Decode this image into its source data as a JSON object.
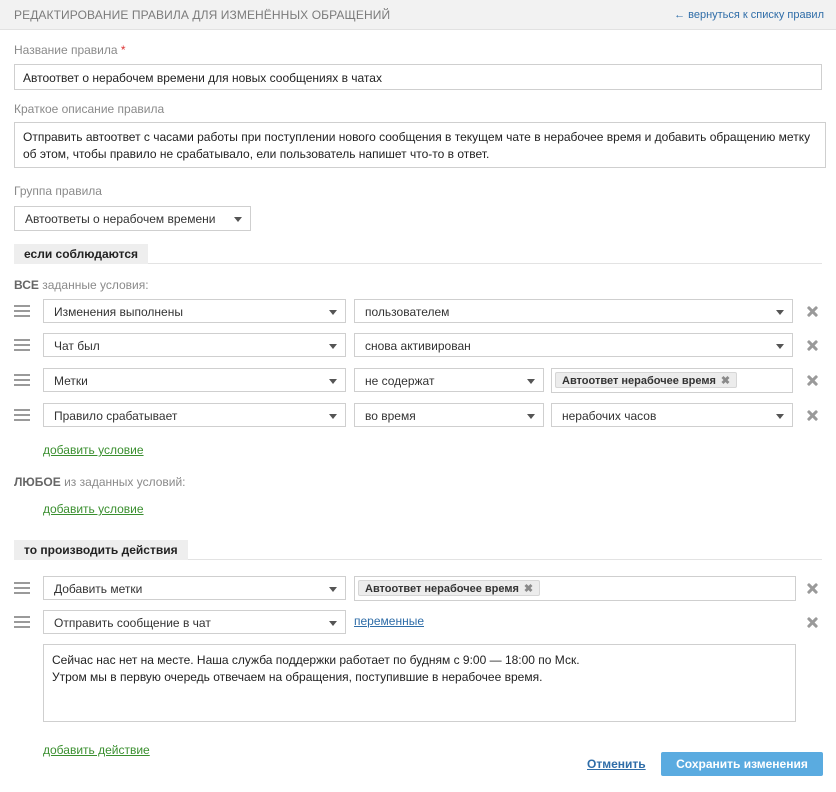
{
  "header": {
    "title": "РЕДАКТИРОВАНИЕ ПРАВИЛА ДЛЯ ИЗМЕНЁННЫХ ОБРАЩЕНИЙ",
    "back_link": "← вернуться к списку правил"
  },
  "rule": {
    "name_label": "Название правила",
    "required_mark": "*",
    "name_value": "Автоответ о нерабочем времени для новых сообщениях в чатах",
    "description_label": "Краткое описание правила",
    "description_value": "Отправить автоответ с часами работы при поступлении нового сообщения в текущем чате в нерабочее время и добавить обращению метку об этом, чтобы правило не срабатывало, ели пользователь напишет что-то в ответ.",
    "group_label": "Группа правила",
    "group_value": "Автоответы о нерабочем времени"
  },
  "conditions": {
    "section_title": "если соблюдаются",
    "all_label_bold": "ВСЕ",
    "all_label_rest": " заданные условия:",
    "rows": [
      {
        "field": "Изменения выполнены",
        "operator": "пользователем"
      },
      {
        "field": "Чат был",
        "operator": "снова активирован"
      },
      {
        "field": "Метки",
        "operator": "не содержат",
        "tag": "Автоответ нерабочее время"
      },
      {
        "field": "Правило срабатывает",
        "operator": "во время",
        "value": "нерабочих часов"
      }
    ],
    "add_condition_all": "добавить условие",
    "any_label_bold": "ЛЮБОЕ",
    "any_label_rest": " из заданных условий:",
    "add_condition_any": "добавить условие"
  },
  "actions": {
    "section_title": "то производить действия",
    "rows": [
      {
        "action": "Добавить метки",
        "tag": "Автоответ нерабочее время"
      },
      {
        "action": "Отправить сообщение в чат",
        "variables_link": "переменные"
      }
    ],
    "message_line1": "Сейчас нас нет на месте. Наша служба поддержки работает по будням с 9:00 — 18:00 по Мск.",
    "message_line2": "Утром мы в первую очередь отвечаем на обращения, поступившие в нерабочее время.",
    "add_action": "добавить действие"
  },
  "footer": {
    "cancel": "Отменить",
    "save": "Сохранить изменения"
  },
  "colors": {
    "link_blue": "#2f6da8",
    "link_green": "#3a8f2f",
    "save_button": "#5aabe0"
  },
  "icons": [
    "drag-handle-icon",
    "remove-icon",
    "tag-remove-icon",
    "chevron-down-icon"
  ]
}
